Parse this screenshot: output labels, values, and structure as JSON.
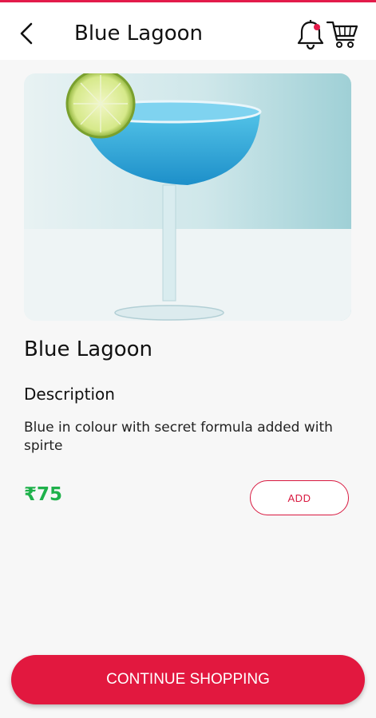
{
  "header": {
    "title": "Blue Lagoon",
    "back_icon": "chevron-left-icon",
    "notification_icon": "bell-icon",
    "cart_icon": "cart-icon",
    "accent_color": "#e31b4a"
  },
  "product": {
    "image_alt": "Blue Lagoon cocktail",
    "name": "Blue Lagoon",
    "description_heading": "Description",
    "description": "Blue in colour with secret formula added with spirte",
    "price": "₹75",
    "add_label": "ADD"
  },
  "footer": {
    "continue_label": "CONTINUE SHOPPING"
  }
}
